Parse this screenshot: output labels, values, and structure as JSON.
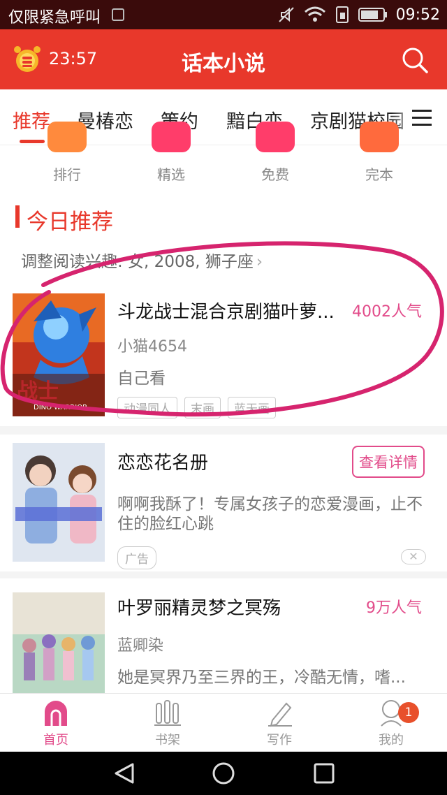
{
  "status_bar": {
    "carrier": "仅限紧急呼叫",
    "time": "09:52"
  },
  "header": {
    "timer": "23:57",
    "title": "话本小说"
  },
  "tabs": [
    {
      "label": "推荐",
      "active": true
    },
    {
      "label": "曼椿恋"
    },
    {
      "label": "策约"
    },
    {
      "label": "黯白恋"
    },
    {
      "label": "京剧猫校园"
    }
  ],
  "categories": [
    {
      "label": "排行",
      "color": "#ff8a3d"
    },
    {
      "label": "精选",
      "color": "#ff3d6a"
    },
    {
      "label": "免费",
      "color": "#ff3d6a"
    },
    {
      "label": "完本",
      "color": "#ff6a3d"
    }
  ],
  "section": {
    "title": "今日推荐",
    "subtitle": "调整阅读兴趣: 女, 2008, 狮子座"
  },
  "books": [
    {
      "title": "斗龙战士混合京剧猫叶萝...",
      "popularity": "4002人气",
      "author": "小猫4654",
      "desc": "自己看",
      "tags": [
        "动漫同人",
        "末画",
        "蓝天画"
      ]
    }
  ],
  "ad": {
    "title": "恋恋花名册",
    "button": "查看详情",
    "desc_line1": "啊啊我酥了！专属女孩子的恋爱漫画，止不",
    "desc_line2": "住的脸红心跳",
    "tag": "广告"
  },
  "book2": {
    "title": "叶罗丽精灵梦之冥殇",
    "popularity": "9万人气",
    "author": "蓝卿染",
    "desc": "她是冥界乃至三界的王，冷酷无情，嗜..."
  },
  "bottom_nav": [
    {
      "label": "首页",
      "active": true
    },
    {
      "label": "书架"
    },
    {
      "label": "写作"
    },
    {
      "label": "我的",
      "badge": "1"
    }
  ],
  "colors": {
    "brand_red": "#e8382b",
    "pink": "#e24b8a"
  }
}
